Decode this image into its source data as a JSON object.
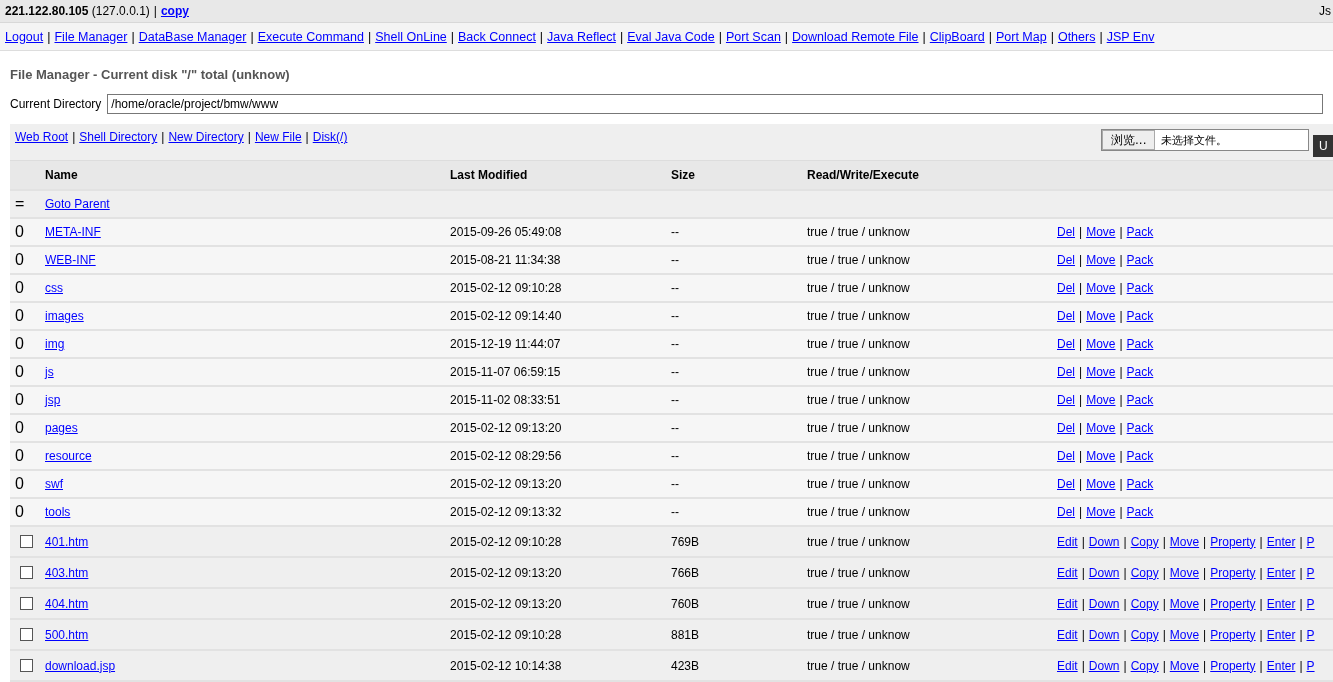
{
  "separator": "|",
  "top_bar": {
    "host": "221.122.80.105",
    "local": "(127.0.0.1)",
    "copy_link": "copy",
    "right_text": "Js"
  },
  "nav": [
    "Logout",
    "File Manager",
    "DataBase Manager",
    "Execute Command",
    "Shell OnLine",
    "Back Connect",
    "Java Reflect",
    "Eval Java Code",
    "Port Scan",
    "Download Remote File",
    "ClipBoard",
    "Port Map",
    "Others",
    "JSP Env"
  ],
  "title": "File Manager - Current disk \"/\" total (unknow)",
  "current_directory": {
    "label": "Current Directory",
    "value": "/home/oracle/project/bmw/www"
  },
  "toolbar": {
    "links": [
      "Web Root",
      "Shell Directory",
      "New Directory",
      "New File",
      "Disk(/)"
    ],
    "browse_button": "浏览...",
    "file_status": "未选择文件。",
    "upload_button": "U"
  },
  "table": {
    "columns": [
      "Name",
      "Last Modified",
      "Size",
      "Read/Write/Execute"
    ],
    "parent": {
      "icon": "=",
      "label": "Goto Parent"
    },
    "rows": [
      {
        "kind": "dir",
        "marker": "0",
        "name": "META-INF",
        "modified": "2015-09-26 05:49:08",
        "size": "--",
        "rwx": "true / true / unknow",
        "actions": [
          "Del",
          "Move",
          "Pack"
        ]
      },
      {
        "kind": "dir",
        "marker": "0",
        "name": "WEB-INF",
        "modified": "2015-08-21 11:34:38",
        "size": "--",
        "rwx": "true / true / unknow",
        "actions": [
          "Del",
          "Move",
          "Pack"
        ]
      },
      {
        "kind": "dir",
        "marker": "0",
        "name": "css",
        "modified": "2015-02-12 09:10:28",
        "size": "--",
        "rwx": "true / true / unknow",
        "actions": [
          "Del",
          "Move",
          "Pack"
        ]
      },
      {
        "kind": "dir",
        "marker": "0",
        "name": "images",
        "modified": "2015-02-12 09:14:40",
        "size": "--",
        "rwx": "true / true / unknow",
        "actions": [
          "Del",
          "Move",
          "Pack"
        ]
      },
      {
        "kind": "dir",
        "marker": "0",
        "name": "img",
        "modified": "2015-12-19 11:44:07",
        "size": "--",
        "rwx": "true / true / unknow",
        "actions": [
          "Del",
          "Move",
          "Pack"
        ]
      },
      {
        "kind": "dir",
        "marker": "0",
        "name": "js",
        "modified": "2015-11-07 06:59:15",
        "size": "--",
        "rwx": "true / true / unknow",
        "actions": [
          "Del",
          "Move",
          "Pack"
        ]
      },
      {
        "kind": "dir",
        "marker": "0",
        "name": "jsp",
        "modified": "2015-11-02 08:33:51",
        "size": "--",
        "rwx": "true / true / unknow",
        "actions": [
          "Del",
          "Move",
          "Pack"
        ]
      },
      {
        "kind": "dir",
        "marker": "0",
        "name": "pages",
        "modified": "2015-02-12 09:13:20",
        "size": "--",
        "rwx": "true / true / unknow",
        "actions": [
          "Del",
          "Move",
          "Pack"
        ]
      },
      {
        "kind": "dir",
        "marker": "0",
        "name": "resource",
        "modified": "2015-02-12 08:29:56",
        "size": "--",
        "rwx": "true / true / unknow",
        "actions": [
          "Del",
          "Move",
          "Pack"
        ]
      },
      {
        "kind": "dir",
        "marker": "0",
        "name": "swf",
        "modified": "2015-02-12 09:13:20",
        "size": "--",
        "rwx": "true / true / unknow",
        "actions": [
          "Del",
          "Move",
          "Pack"
        ]
      },
      {
        "kind": "dir",
        "marker": "0",
        "name": "tools",
        "modified": "2015-02-12 09:13:32",
        "size": "--",
        "rwx": "true / true / unknow",
        "actions": [
          "Del",
          "Move",
          "Pack"
        ]
      },
      {
        "kind": "file",
        "checked": false,
        "name": "401.htm",
        "modified": "2015-02-12 09:10:28",
        "size": "769B",
        "rwx": "true / true / unknow",
        "actions": [
          "Edit",
          "Down",
          "Copy",
          "Move",
          "Property",
          "Enter",
          "P"
        ]
      },
      {
        "kind": "file",
        "checked": false,
        "name": "403.htm",
        "modified": "2015-02-12 09:13:20",
        "size": "766B",
        "rwx": "true / true / unknow",
        "actions": [
          "Edit",
          "Down",
          "Copy",
          "Move",
          "Property",
          "Enter",
          "P"
        ]
      },
      {
        "kind": "file",
        "checked": false,
        "name": "404.htm",
        "modified": "2015-02-12 09:13:20",
        "size": "760B",
        "rwx": "true / true / unknow",
        "actions": [
          "Edit",
          "Down",
          "Copy",
          "Move",
          "Property",
          "Enter",
          "P"
        ]
      },
      {
        "kind": "file",
        "checked": false,
        "name": "500.htm",
        "modified": "2015-02-12 09:10:28",
        "size": "881B",
        "rwx": "true / true / unknow",
        "actions": [
          "Edit",
          "Down",
          "Copy",
          "Move",
          "Property",
          "Enter",
          "P"
        ]
      },
      {
        "kind": "file",
        "checked": false,
        "name": "download.jsp",
        "modified": "2015-02-12 10:14:38",
        "size": "423B",
        "rwx": "true / true / unknow",
        "actions": [
          "Edit",
          "Down",
          "Copy",
          "Move",
          "Property",
          "Enter",
          "P"
        ]
      }
    ]
  }
}
